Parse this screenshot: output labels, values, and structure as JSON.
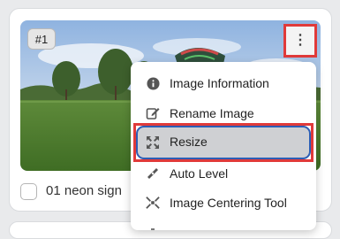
{
  "card": {
    "badge": "#1",
    "image_name": "01 neon sign",
    "menu_button_icon": "kebab-vertical-icon",
    "checkbox_checked": false
  },
  "context_menu": {
    "items": [
      {
        "label": "Image Information",
        "icon": "info-circle-icon"
      },
      {
        "label": "Rename Image",
        "icon": "edit-icon"
      },
      {
        "label": "Resize",
        "icon": "resize-icon",
        "selected": true
      },
      {
        "label": "Auto Level",
        "icon": "level-icon"
      },
      {
        "label": "Image Centering Tool",
        "icon": "centering-icon"
      }
    ]
  },
  "colors": {
    "highlight_red": "#e03a3a",
    "focus_blue": "#2c5db5",
    "selected_bg": "#cfd0d3"
  }
}
